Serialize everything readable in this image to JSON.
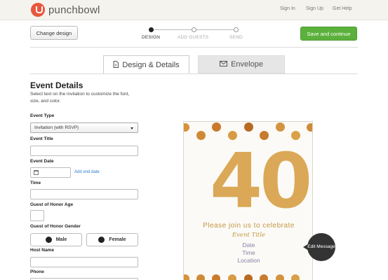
{
  "nav": {
    "brand": "punchbowl",
    "links": [
      "Sign In",
      "Sign Up",
      "Get Help"
    ]
  },
  "toolbar": {
    "change_design": "Change design",
    "save_continue": "Save and continue",
    "steps": [
      {
        "label": "DESIGN",
        "active": true
      },
      {
        "label": "ADD GUESTS",
        "active": false
      },
      {
        "label": "SEND",
        "active": false
      }
    ]
  },
  "tabs": [
    {
      "label": "Design & Details",
      "icon": "document-icon",
      "active": true
    },
    {
      "label": "Envelope",
      "icon": "envelope-icon",
      "active": false
    }
  ],
  "form": {
    "heading": "Event Details",
    "subtext": "Select text on the invitation to customize the font, size, and color.",
    "event_type_label": "Event Type",
    "event_type_value": "Invitation (with RSVP)",
    "event_title_label": "Event Title",
    "event_date_label": "Event Date",
    "add_end_date": "Add end date",
    "time_label": "Time",
    "honor_age_label": "Guest of Honor Age",
    "honor_gender_label": "Guest of Honor Gender",
    "gender_options": [
      "Male",
      "Female"
    ],
    "host_name_label": "Host Name",
    "phone_label": "Phone"
  },
  "invitation": {
    "big_number": "40",
    "line1": "Please join us to celebrate",
    "line2": "Event Title",
    "line3": "Date",
    "line4": "Time",
    "line5": "Location",
    "edit_message": "Edit Message",
    "accent_color": "#d9a24a"
  },
  "colors": {
    "brand": "#e8563e",
    "primary_button": "#5bb13b",
    "link": "#2a7bd1"
  }
}
